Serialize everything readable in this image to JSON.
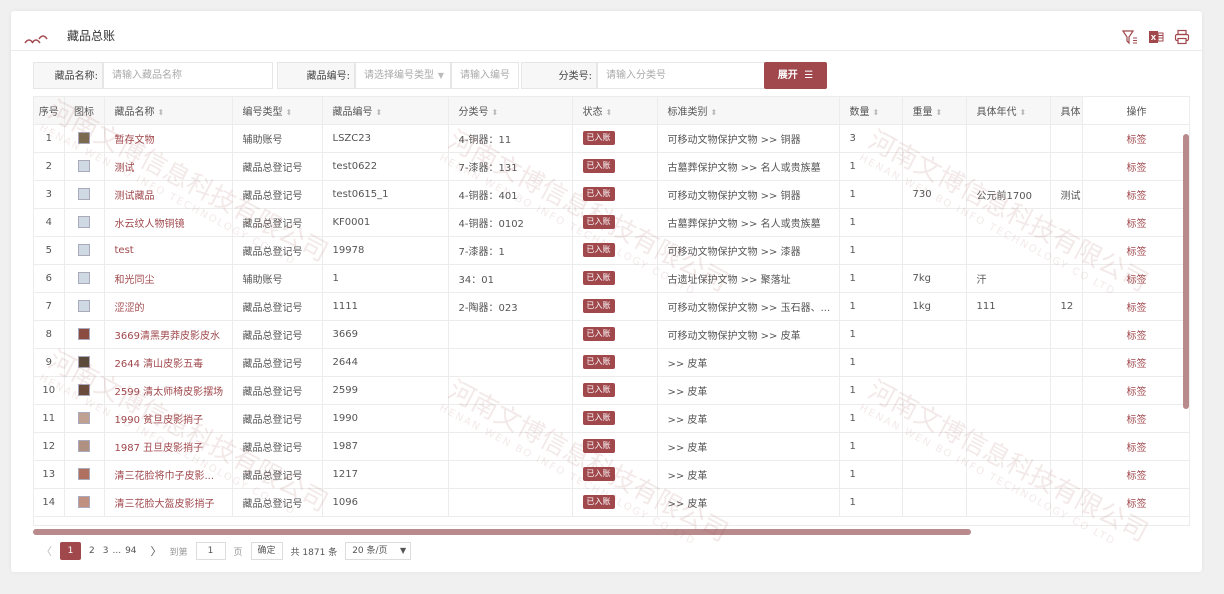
{
  "header": {
    "title": "藏品总账"
  },
  "filters": {
    "name_label": "藏品名称:",
    "name_placeholder": "请输入藏品名称",
    "code_label": "藏品编号:",
    "code_type_placeholder": "请选择编号类型",
    "code_placeholder": "请输入编号",
    "class_label": "分类号:",
    "class_placeholder": "请输入分类号",
    "expand_label": "展开"
  },
  "table": {
    "columns": [
      "序号",
      "图标",
      "藏品名称",
      "编号类型",
      "藏品编号",
      "分类号",
      "状态",
      "标准类别",
      "数量",
      "重量",
      "具体年代",
      "具体",
      "操作"
    ],
    "rows": [
      {
        "idx": "1",
        "name": "暂存文物",
        "code_type": "辅助账号",
        "code": "LSZC23",
        "class": "4-铜器：11",
        "status": "已入账",
        "category": "可移动文物保护文物 >> 铜器",
        "qty": "3",
        "weight": "",
        "era": "",
        "spec": "",
        "op": "标签"
      },
      {
        "idx": "2",
        "name": "测试",
        "code_type": "藏品总登记号",
        "code": "test0622",
        "class": "7-漆器：131",
        "status": "已入账",
        "category": "古墓葬保护文物 >> 名人或贵族墓",
        "qty": "1",
        "weight": "",
        "era": "",
        "spec": "",
        "op": "标签"
      },
      {
        "idx": "3",
        "name": "测试藏品",
        "code_type": "藏品总登记号",
        "code": "test0615_1",
        "class": "4-铜器：401",
        "status": "已入账",
        "category": "可移动文物保护文物 >> 铜器",
        "qty": "1",
        "weight": "730",
        "era": "公元前1700",
        "spec": "测试",
        "op": "标签"
      },
      {
        "idx": "4",
        "name": "水云纹人物铜镜",
        "code_type": "藏品总登记号",
        "code": "KF0001",
        "class": "4-铜器：0102",
        "status": "已入账",
        "category": "古墓葬保护文物 >> 名人或贵族墓",
        "qty": "1",
        "weight": "",
        "era": "",
        "spec": "",
        "op": "标签"
      },
      {
        "idx": "5",
        "name": "test",
        "code_type": "藏品总登记号",
        "code": "19978",
        "class": "7-漆器：1",
        "status": "已入账",
        "category": "可移动文物保护文物 >> 漆器",
        "qty": "1",
        "weight": "",
        "era": "",
        "spec": "",
        "op": "标签"
      },
      {
        "idx": "6",
        "name": "和光同尘",
        "code_type": "辅助账号",
        "code": "1",
        "class": "34：01",
        "status": "已入账",
        "category": "古遗址保护文物 >> 聚落址",
        "qty": "1",
        "weight": "7kg",
        "era": "汗",
        "spec": "",
        "op": "标签"
      },
      {
        "idx": "7",
        "name": "涩涩的",
        "code_type": "藏品总登记号",
        "code": "1111",
        "class": "2-陶器：023",
        "status": "已入账",
        "category": "可移动文物保护文物 >> 玉石器、...",
        "qty": "1",
        "weight": "1kg",
        "era": "111",
        "spec": "12",
        "op": "标签"
      },
      {
        "idx": "8",
        "name": "3669清黑男莽皮影皮水",
        "code_type": "藏品总登记号",
        "code": "3669",
        "class": "",
        "status": "已入账",
        "category": "可移动文物保护文物 >> 皮革",
        "qty": "1",
        "weight": "",
        "era": "",
        "spec": "",
        "op": "标签"
      },
      {
        "idx": "9",
        "name": "2644 清山皮影五毒",
        "code_type": "藏品总登记号",
        "code": "2644",
        "class": "",
        "status": "已入账",
        "category": ">> 皮革",
        "qty": "1",
        "weight": "",
        "era": "",
        "spec": "",
        "op": "标签"
      },
      {
        "idx": "10",
        "name": "2599 清太师椅皮影摆场",
        "code_type": "藏品总登记号",
        "code": "2599",
        "class": "",
        "status": "已入账",
        "category": ">> 皮革",
        "qty": "1",
        "weight": "",
        "era": "",
        "spec": "",
        "op": "标签"
      },
      {
        "idx": "11",
        "name": "1990 贫旦皮影捎子",
        "code_type": "藏品总登记号",
        "code": "1990",
        "class": "",
        "status": "已入账",
        "category": ">> 皮革",
        "qty": "1",
        "weight": "",
        "era": "",
        "spec": "",
        "op": "标签"
      },
      {
        "idx": "12",
        "name": "1987 丑旦皮影捎子",
        "code_type": "藏品总登记号",
        "code": "1987",
        "class": "",
        "status": "已入账",
        "category": ">> 皮革",
        "qty": "1",
        "weight": "",
        "era": "",
        "spec": "",
        "op": "标签"
      },
      {
        "idx": "13",
        "name": "清三花脸将巾子皮影...",
        "code_type": "藏品总登记号",
        "code": "1217",
        "class": "",
        "status": "已入账",
        "category": ">> 皮革",
        "qty": "1",
        "weight": "",
        "era": "",
        "spec": "",
        "op": "标签"
      },
      {
        "idx": "14",
        "name": "清三花脸大盔皮影捎子",
        "code_type": "藏品总登记号",
        "code": "1096",
        "class": "",
        "status": "已入账",
        "category": ">> 皮革",
        "qty": "1",
        "weight": "",
        "era": "",
        "spec": "",
        "op": "标签"
      }
    ]
  },
  "pagination": {
    "pages": [
      "1",
      "2",
      "3",
      "...",
      "94"
    ],
    "goto_label": "到第",
    "goto_value": "1",
    "page_unit": "页",
    "confirm_label": "确定",
    "total_text": "共 1871 条",
    "page_size": "20 条/页"
  },
  "watermark": {
    "cn": "河南文博信息科技有限公司",
    "en": "HENAN WEN BO INFO TECHNOLOGY CO LTD"
  }
}
